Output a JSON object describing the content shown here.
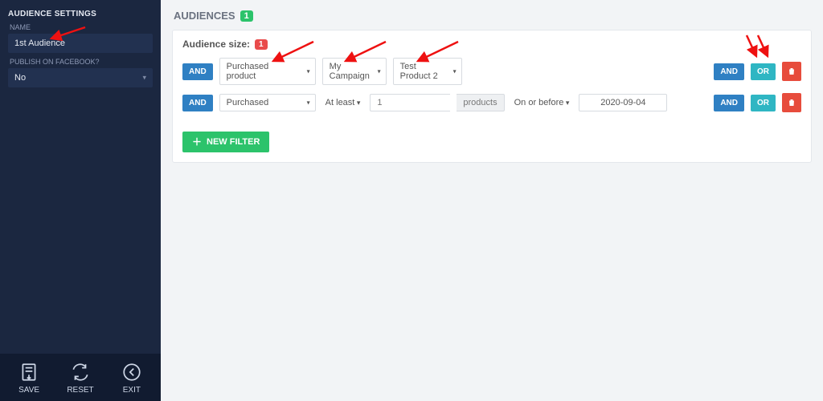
{
  "sidebar": {
    "title": "AUDIENCE SETTINGS",
    "name_label": "NAME",
    "name_value": "1st Audience",
    "fb_label": "PUBLISH ON FACEBOOK?",
    "fb_value": "No",
    "save": "SAVE",
    "reset": "RESET",
    "exit": "EXIT"
  },
  "page": {
    "title": "AUDIENCES",
    "count": "1"
  },
  "panel": {
    "size_label": "Audience size:",
    "size_value": "1",
    "and": "AND",
    "or": "OR",
    "row1": {
      "sel1": "Purchased product",
      "sel2": "My Campaign",
      "sel3": "Test Product 2"
    },
    "row2": {
      "sel1": "Purchased",
      "cond": "At least",
      "qty": "1",
      "unit": "products",
      "date_cond": "On or before",
      "date": "2020-09-04"
    },
    "new_filter": "NEW FILTER"
  }
}
